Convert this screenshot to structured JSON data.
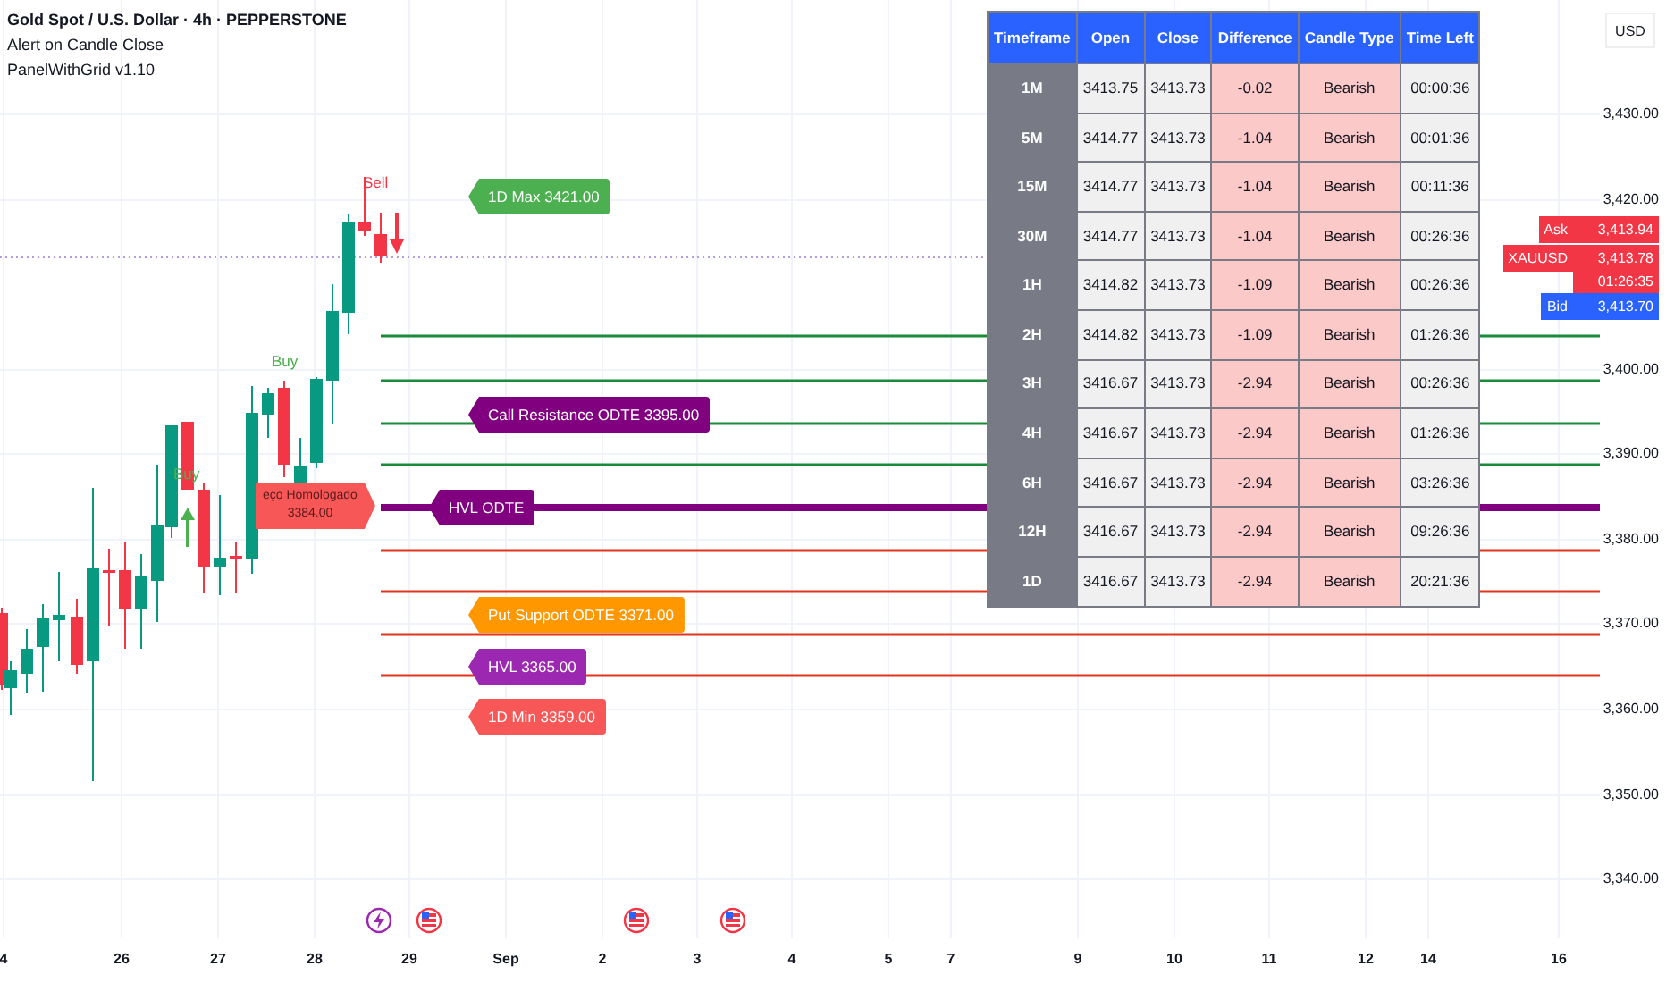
{
  "legend": {
    "title": "Gold Spot / U.S. Dollar · 4h · PEPPERSTONE",
    "indicators": [
      "Alert on Candle Close",
      "PanelWithGrid v1.10"
    ]
  },
  "currency": "USD",
  "price_axis": [
    "3,430.00",
    "3,420.00",
    "3,400.00",
    "3,390.00",
    "3,380.00",
    "3,370.00",
    "3,360.00",
    "3,350.00",
    "3,340.00"
  ],
  "price_tags": [
    {
      "kind": "ask",
      "label": "Ask",
      "price": "3,413.94"
    },
    {
      "kind": "last",
      "label": "XAUUSD",
      "price": "3,413.78",
      "countdown": "01:26:35"
    },
    {
      "kind": "bid",
      "label": "Bid",
      "price": "3,413.70"
    }
  ],
  "time_axis": [
    "4",
    "26",
    "27",
    "28",
    "29",
    "Sep",
    "2",
    "3",
    "4",
    "5",
    "7",
    "9",
    "10",
    "11",
    "12",
    "14",
    "16"
  ],
  "signals": [
    {
      "kind": "sell",
      "label": "Sell"
    },
    {
      "kind": "buy",
      "label": "Buy"
    },
    {
      "kind": "buy",
      "label": "Buy"
    }
  ],
  "price_note": {
    "lines": [
      "eço Homologado",
      "3384.00"
    ]
  },
  "level_lines": [
    {
      "color": "#1b8a3a"
    },
    {
      "color": "#1b8a3a"
    },
    {
      "color": "#1b8a3a"
    },
    {
      "color": "#1b8a3a"
    },
    {
      "color": "#800080"
    },
    {
      "color": "#e2341d"
    },
    {
      "color": "#e2341d"
    },
    {
      "color": "#e2341d"
    },
    {
      "color": "#e2341d"
    }
  ],
  "level_labels": [
    {
      "text": "1D Max 3421.00",
      "color": "#4caf50"
    },
    {
      "text": "Call Resistance ODTE 3395.00",
      "color": "#800080"
    },
    {
      "text": "HVL ODTE",
      "color": "#800080"
    },
    {
      "text": "Put Support ODTE 3371.00",
      "color": "#ff9800"
    },
    {
      "text": "HVL 3365.00",
      "color": "#9c27b0"
    },
    {
      "text": "1D Min 3359.00",
      "color": "#f75757"
    }
  ],
  "panel": {
    "columns": [
      "Timeframe",
      "Open",
      "Close",
      "Difference",
      "Candle Type",
      "Time Left"
    ],
    "rows": [
      {
        "timeframe": "1M",
        "open": "3413.75",
        "close": "3413.73",
        "difference": "-0.02",
        "candle_type": "Bearish",
        "time_left": "00:00:36",
        "bearish": true
      },
      {
        "timeframe": "5M",
        "open": "3414.77",
        "close": "3413.73",
        "difference": "-1.04",
        "candle_type": "Bearish",
        "time_left": "00:01:36",
        "bearish": true
      },
      {
        "timeframe": "15M",
        "open": "3414.77",
        "close": "3413.73",
        "difference": "-1.04",
        "candle_type": "Bearish",
        "time_left": "00:11:36",
        "bearish": true
      },
      {
        "timeframe": "30M",
        "open": "3414.77",
        "close": "3413.73",
        "difference": "-1.04",
        "candle_type": "Bearish",
        "time_left": "00:26:36",
        "bearish": true
      },
      {
        "timeframe": "1H",
        "open": "3414.82",
        "close": "3413.73",
        "difference": "-1.09",
        "candle_type": "Bearish",
        "time_left": "00:26:36",
        "bearish": true
      },
      {
        "timeframe": "2H",
        "open": "3414.82",
        "close": "3413.73",
        "difference": "-1.09",
        "candle_type": "Bearish",
        "time_left": "01:26:36",
        "bearish": true
      },
      {
        "timeframe": "3H",
        "open": "3416.67",
        "close": "3413.73",
        "difference": "-2.94",
        "candle_type": "Bearish",
        "time_left": "00:26:36",
        "bearish": true
      },
      {
        "timeframe": "4H",
        "open": "3416.67",
        "close": "3413.73",
        "difference": "-2.94",
        "candle_type": "Bearish",
        "time_left": "01:26:36",
        "bearish": true
      },
      {
        "timeframe": "6H",
        "open": "3416.67",
        "close": "3413.73",
        "difference": "-2.94",
        "candle_type": "Bearish",
        "time_left": "03:26:36",
        "bearish": true
      },
      {
        "timeframe": "12H",
        "open": "3416.67",
        "close": "3413.73",
        "difference": "-2.94",
        "candle_type": "Bearish",
        "time_left": "09:26:36",
        "bearish": true
      },
      {
        "timeframe": "1D",
        "open": "3416.67",
        "close": "3413.73",
        "difference": "-2.94",
        "candle_type": "Bearish",
        "time_left": "20:21:36",
        "bearish": true
      }
    ]
  }
}
